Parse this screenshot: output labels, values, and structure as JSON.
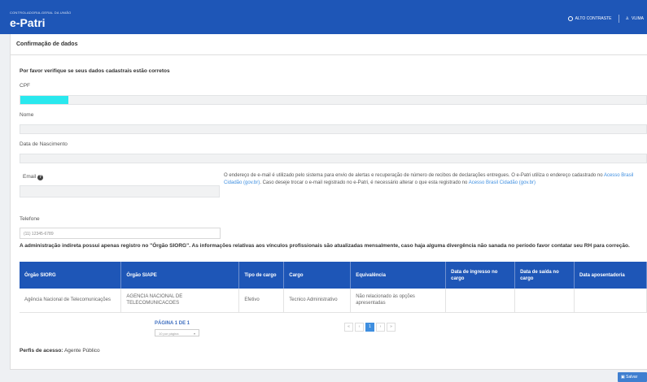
{
  "header": {
    "org": "CONTROLADORIA-GERAL DA UNIÃO",
    "brand": "e-Patri",
    "contrast_label": "ALTO CONTRASTE",
    "user_label": "VLIMA"
  },
  "panel": {
    "title": "Confirmação de dados"
  },
  "form": {
    "intro": "Por favor verifique se seus dados cadastrais estão corretos",
    "cpf_label": "CPF",
    "name_label": "Nome",
    "birth_label": "Data de Nascimento",
    "email_label": "Email",
    "email_help_1": "O endereço de e-mail é utilizado pelo sistema para envio de alertas e recuperação de número de recibos de declarações entregues. O e-Patri utiliza o endereço cadastrado no ",
    "email_help_link": "Acesso Brasil Cidadão (gov.br)",
    "email_help_2": ". Caso deseje trocar o e-mail registrado no e-Patri, é necessário alterar o que esta registrado no ",
    "email_help_link2": "Acesso Brasil Cidadão (gov.br)",
    "phone_label": "Telefone",
    "phone_value": "(11) 12345-6789"
  },
  "notice": "A administração indireta possui apenas registro no \"Órgão SIORG\". As informações relativas aos vínculos profissionais são atualizadas mensalmente, caso haja alguma divergência não sanada no período favor contatar seu RH para correção.",
  "table": {
    "headers": [
      "Órgão SIORG",
      "Órgão SIAPE",
      "Tipo de cargo",
      "Cargo",
      "Equivalência",
      "Data de ingresso no cargo",
      "Data de saída no cargo",
      "Data aposentadoria"
    ],
    "rows": [
      [
        "Agência Nacional de Telecomunicações",
        "AGENCIA NACIONAL DE TELECOMUNICACOES",
        "Efetivo",
        "Tecnico Administrativo",
        "Não relacionado às opções apresentadas",
        "",
        "",
        ""
      ]
    ]
  },
  "pagination": {
    "info": "PÁGINA 1 DE 1",
    "per_page": "10 por página",
    "first": "«",
    "prev": "‹",
    "current": "1",
    "next": "›",
    "last": "»"
  },
  "profile": {
    "label": "Perfis de acesso:",
    "value": "Agente Público"
  },
  "actions": {
    "save": "Salvar"
  },
  "colors": {
    "brand": "#1e56b7",
    "accent": "#3f8fe0",
    "highlight": "#29e8ee"
  }
}
